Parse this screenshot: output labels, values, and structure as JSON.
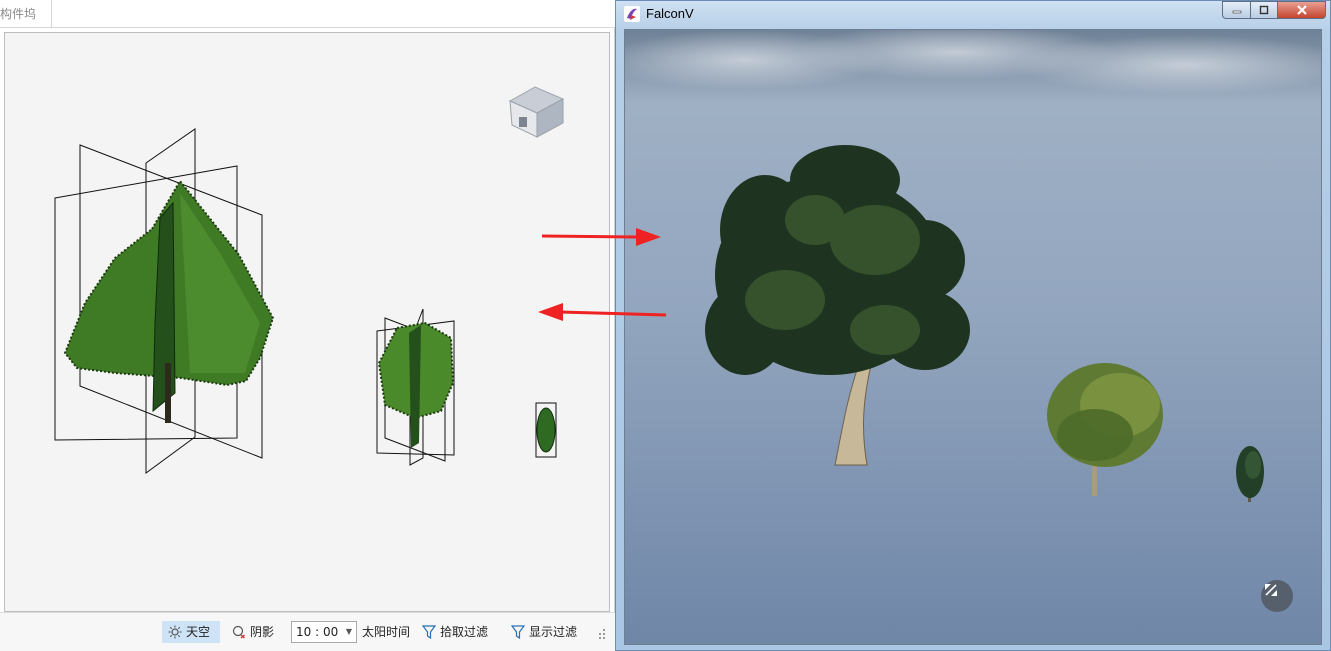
{
  "left_app": {
    "tab_label": "构件坞",
    "statusbar": {
      "sky_label": "天空",
      "shadow_label": "阴影",
      "time_value": "10 : 00",
      "sun_time_label": "太阳时间",
      "pick_filter_label": "拾取过滤",
      "display_filter_label": "显示过滤"
    }
  },
  "falcon_window": {
    "title": "FalconV"
  },
  "colors": {
    "accent_arrow": "#ee2222",
    "sky_button_bg": "#cfe3f7",
    "close_button": "#c5432f"
  },
  "icons": {
    "navigation_cube": "home-cube-icon",
    "sky": "sun-icon",
    "shadow": "shadow-icon",
    "pick_filter": "filter-icon",
    "display_filter": "filter-icon",
    "fullscreen": "fullscreen-toggle-icon"
  }
}
